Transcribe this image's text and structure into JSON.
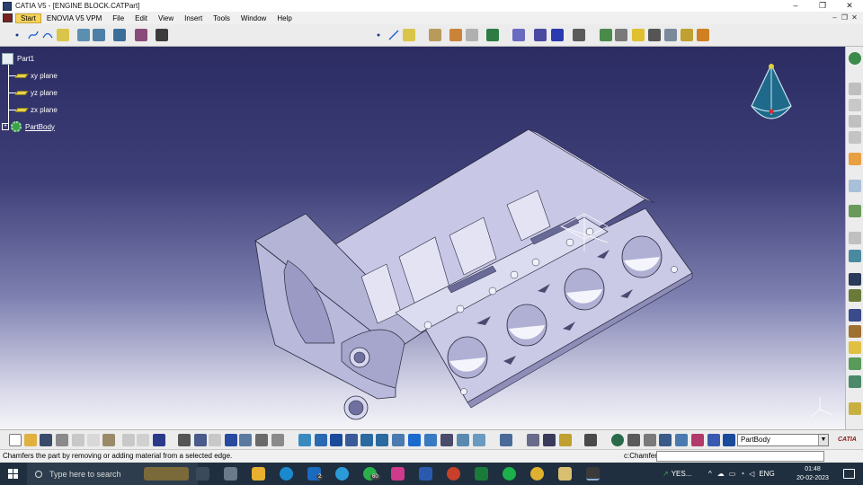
{
  "window": {
    "title": "CATIA V5 - [ENGINE BLOCK.CATPart]",
    "controls": [
      "–",
      "❐",
      "✕"
    ],
    "mdi_controls": [
      "–",
      "❐",
      "✕"
    ]
  },
  "menu": {
    "items": [
      "Start",
      "ENOVIA V5 VPM",
      "File",
      "Edit",
      "View",
      "Insert",
      "Tools",
      "Window",
      "Help"
    ]
  },
  "tree": {
    "root": "Part1",
    "children": [
      "xy plane",
      "yz plane",
      "zx plane"
    ],
    "body": "PartBody"
  },
  "bottom_toolbar": {
    "current_body": "PartBody"
  },
  "status": {
    "message": "Chamfers the part by removing or adding material from a selected edge.",
    "command_label": "c:Chamfer",
    "command_value": ""
  },
  "taskbar": {
    "search_placeholder": "Type here to search",
    "mail_badge": "2",
    "whatsapp_badge": "60",
    "weather": "YES...",
    "language": "ENG",
    "time": "01:48",
    "date": "20-02-2023"
  },
  "colors": {
    "viewport_top": "#2c2c63",
    "viewport_bottom": "#f4f4f8",
    "part_fill": "#c3c3e2",
    "part_light": "#e3e3f4",
    "part_dark": "#8d8db8",
    "tree_text": "#ffffff",
    "taskbar": "#1f2f3f"
  }
}
